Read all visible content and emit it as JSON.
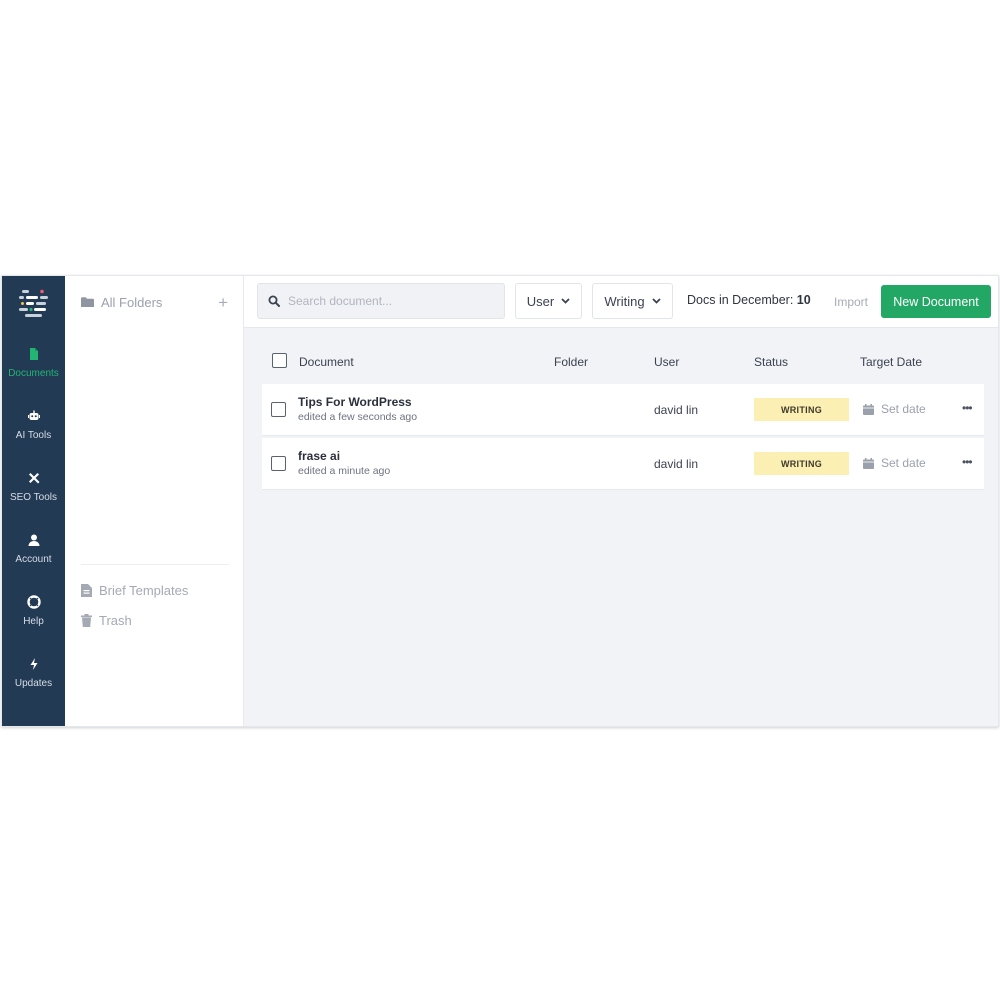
{
  "nav": {
    "items": [
      {
        "label": "Documents",
        "icon": "document-icon"
      },
      {
        "label": "AI Tools",
        "icon": "robot-icon"
      },
      {
        "label": "SEO Tools",
        "icon": "tools-icon"
      },
      {
        "label": "Account",
        "icon": "user-icon"
      },
      {
        "label": "Help",
        "icon": "lifebuoy-icon"
      },
      {
        "label": "Updates",
        "icon": "bolt-icon"
      }
    ],
    "active": "Documents",
    "active_color": "#22b473",
    "background": "#233a55"
  },
  "folders": {
    "all_folders": "All Folders",
    "add_icon": "plus-icon",
    "brief_templates": "Brief Templates",
    "trash": "Trash"
  },
  "toolbar": {
    "search_placeholder": "Search document...",
    "user_filter": "User",
    "status_filter": "Writing",
    "docs_label": "Docs in December: ",
    "docs_count": "10",
    "import_label": "Import",
    "new_document_label": "New Document",
    "new_document_color": "#22a765"
  },
  "table": {
    "headers": {
      "document": "Document",
      "folder": "Folder",
      "user": "User",
      "status": "Status",
      "target_date": "Target Date"
    },
    "rows": [
      {
        "title": "Tips For WordPress",
        "edited": "edited a few seconds ago",
        "folder": "",
        "user": "david lin",
        "status": "WRITING",
        "target_date": "Set date",
        "more": "•••"
      },
      {
        "title": "frase ai",
        "edited": "edited a minute ago",
        "folder": "",
        "user": "david lin",
        "status": "WRITING",
        "target_date": "Set date",
        "more": "•••"
      }
    ],
    "status_color": "#fcefb3"
  }
}
